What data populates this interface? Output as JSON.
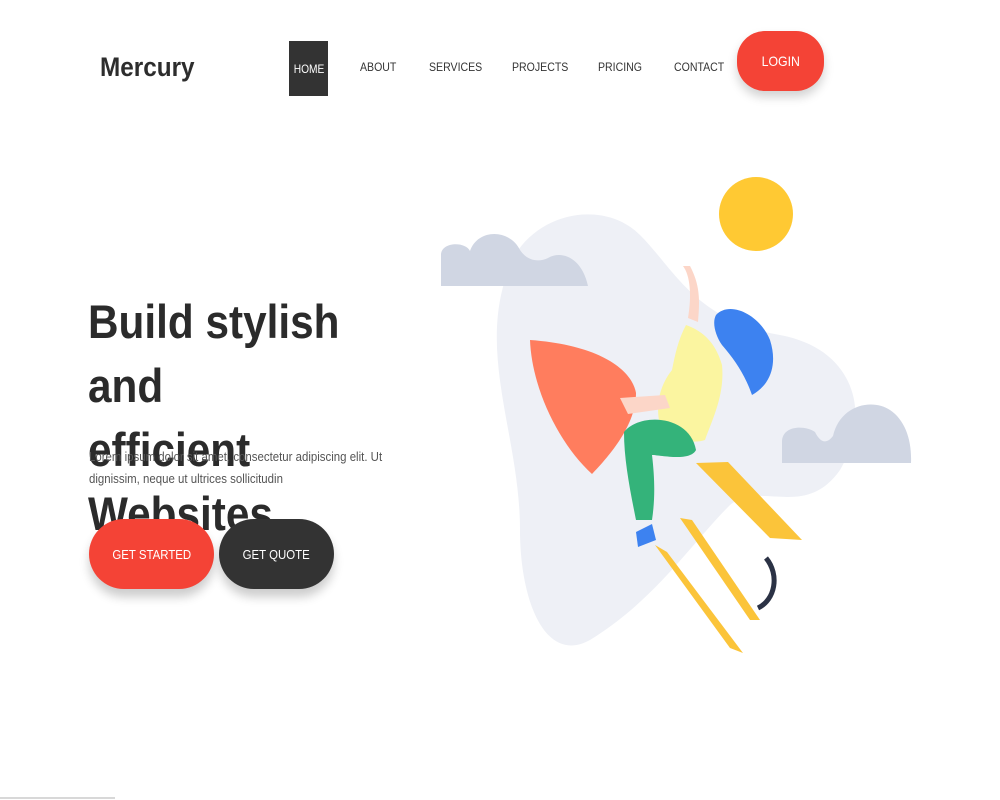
{
  "brand": {
    "name": "Mercury"
  },
  "nav": {
    "items": [
      {
        "label": "HOME",
        "active": true
      },
      {
        "label": "ABOUT"
      },
      {
        "label": "SERVICES"
      },
      {
        "label": "PROJECTS"
      },
      {
        "label": "PRICING"
      },
      {
        "label": "CONTACT"
      }
    ],
    "login_label": "LOGIN"
  },
  "hero": {
    "title_line1": "Build stylish and",
    "title_line2": "efficient Websites",
    "text": "Lorem ipsum dolor sit amet, consectetur adipiscing elit. Ut dignissim, neque ut ultrices sollicitudin",
    "primary_button": "GET STARTED",
    "secondary_button": "GET QUOTE"
  },
  "colors": {
    "accent": "#f44336",
    "dark": "#333333",
    "sun": "#ffc933",
    "blob": "#eef0f6",
    "cloud": "#d0d6e3",
    "rocket_fin": "#ff7d5e",
    "shirt": "#fbf5a0",
    "pants": "#34b37a",
    "hair": "#3d82f0",
    "flame": "#fbc43a"
  },
  "illustration": {
    "name": "rocket-woman-illustration"
  }
}
